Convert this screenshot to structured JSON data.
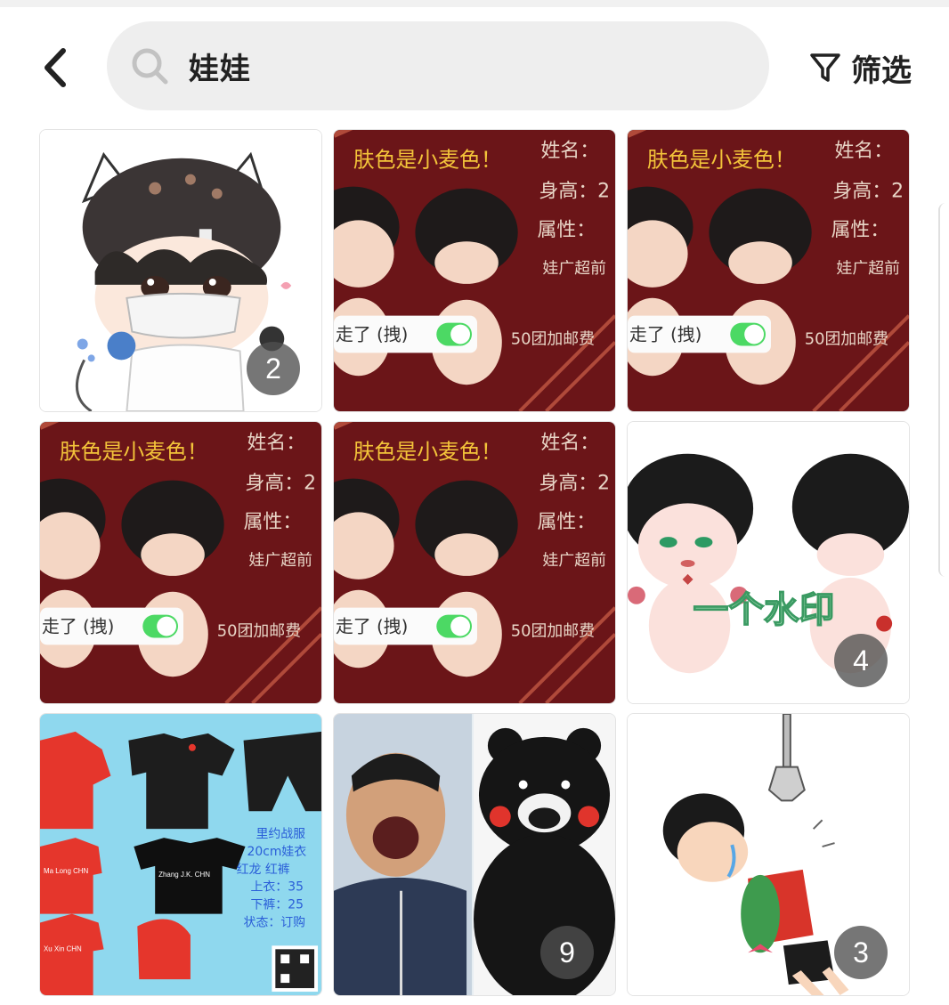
{
  "header": {
    "search_query": "娃娃",
    "filter_label": "筛选"
  },
  "tiles": [
    {
      "badge": "2"
    },
    {
      "caption": "肤色是小麦色！",
      "side_text": [
        "姓名：",
        "身高：2",
        "属性：",
        "娃广超前",
        "50团加邮费"
      ],
      "toggle_text": "走了 (拽)"
    },
    {
      "caption": "肤色是小麦色！",
      "side_text": [
        "姓名：",
        "身高：2",
        "属性：",
        "娃广超前",
        "50团加邮费"
      ],
      "toggle_text": "走了 (拽)"
    },
    {
      "caption": "肤色是小麦色！",
      "side_text": [
        "姓名：",
        "身高：2",
        "属性：",
        "娃广超前",
        "50团加邮费"
      ],
      "toggle_text": "走了 (拽)"
    },
    {
      "caption": "肤色是小麦色！",
      "side_text": [
        "姓名：",
        "身高：2",
        "属性：",
        "娃广超前",
        "50团加邮费"
      ],
      "toggle_text": "走了 (拽)"
    },
    {
      "watermark": "一个水印",
      "badge": "4"
    },
    {
      "shirt_labels": [
        "Ma Long CHN",
        "Zhang J.K. CHN",
        "Xu Xin CHN"
      ],
      "side_text": [
        "里约战服",
        "20cm娃衣",
        "红龙 红裤",
        "上衣：35",
        "下裤：25",
        "状态：订购"
      ]
    },
    {
      "badge": "9"
    },
    {
      "badge": "3"
    }
  ],
  "colors": {
    "maroon": "#6b1518",
    "gold_text": "#f3c43a",
    "sky_blue": "#8fd8ee",
    "badge_bg": "#555555"
  }
}
